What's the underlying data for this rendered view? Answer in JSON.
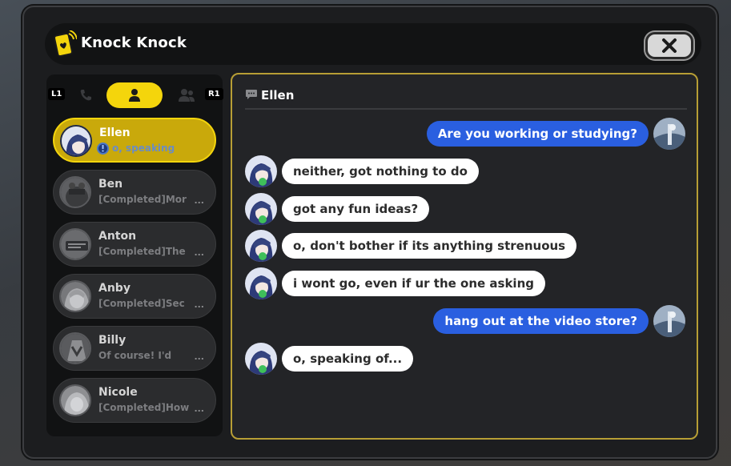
{
  "app": {
    "title": "Knock Knock"
  },
  "tabs": {
    "left_key": "L1",
    "right_key": "R1",
    "items": [
      {
        "icon": "phone-icon",
        "active": false
      },
      {
        "icon": "person-icon",
        "active": true
      },
      {
        "icon": "group-icon",
        "active": false
      }
    ]
  },
  "contacts": [
    {
      "name": "Ellen",
      "preview": "o, speaking",
      "active": true
    },
    {
      "name": "Ben",
      "preview": "[Completed]Mor",
      "ellipsis": "...",
      "active": false
    },
    {
      "name": "Anton",
      "preview": "[Completed]The",
      "ellipsis": "...",
      "active": false
    },
    {
      "name": "Anby",
      "preview": "[Completed]Sec",
      "ellipsis": "...",
      "active": false
    },
    {
      "name": "Billy",
      "preview": "Of course! I'd",
      "ellipsis": "...",
      "active": false
    },
    {
      "name": "Nicole",
      "preview": "[Completed]How",
      "ellipsis": "...",
      "active": false
    }
  ],
  "chat": {
    "header_name": "Ellen",
    "messages": [
      {
        "from": "me",
        "text": "Are you working or studying?"
      },
      {
        "from": "Ellen",
        "text": "neither, got nothing to do"
      },
      {
        "from": "Ellen",
        "text": "got any fun ideas?"
      },
      {
        "from": "Ellen",
        "text": "o, don't bother if its anything strenuous"
      },
      {
        "from": "Ellen",
        "text": "i wont go, even if ur the one asking"
      },
      {
        "from": "me",
        "text": "hang out at the video store?"
      },
      {
        "from": "Ellen",
        "text": "o, speaking of..."
      }
    ]
  },
  "colors": {
    "accent_yellow": "#f4d50c",
    "outgoing_bubble": "#2a5fe0",
    "incoming_bubble": "#ffffff",
    "panel_border": "#b79e35"
  }
}
